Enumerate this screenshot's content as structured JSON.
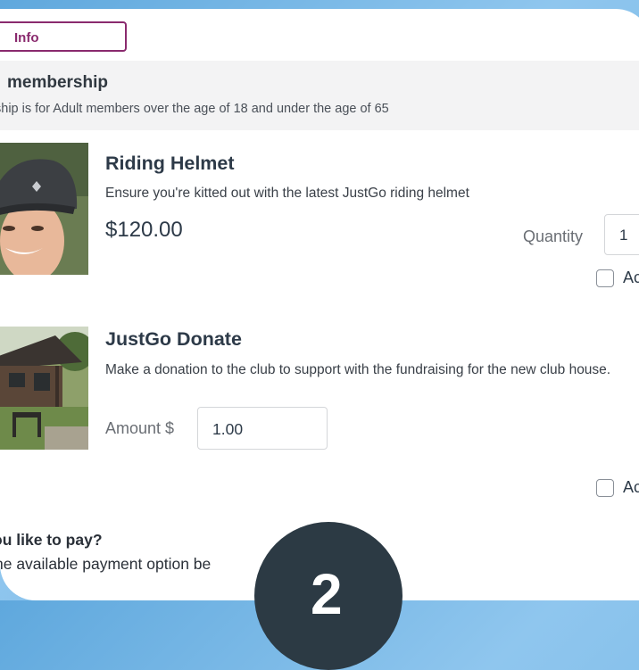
{
  "info_tab": {
    "label": "Info"
  },
  "membership": {
    "title": "membership",
    "description": "ship is for Adult members over the age of 18 and under the age of 65"
  },
  "products": [
    {
      "title": "Riding Helmet",
      "description": "Ensure you're kitted out with the latest JustGo riding helmet",
      "price": "$120.00",
      "quantity_label": "Quantity",
      "quantity_value": "1",
      "add_label": "Ac"
    },
    {
      "title": "JustGo Donate",
      "description": "Make a donation to the club to support with the fundraising for the new club house.",
      "amount_label": "Amount $",
      "amount_value": "1.00",
      "add_label": "Ac"
    }
  ],
  "payment": {
    "title": "ou like to pay?",
    "description": "he available payment option be"
  },
  "overlay_badge": {
    "text": "2"
  }
}
